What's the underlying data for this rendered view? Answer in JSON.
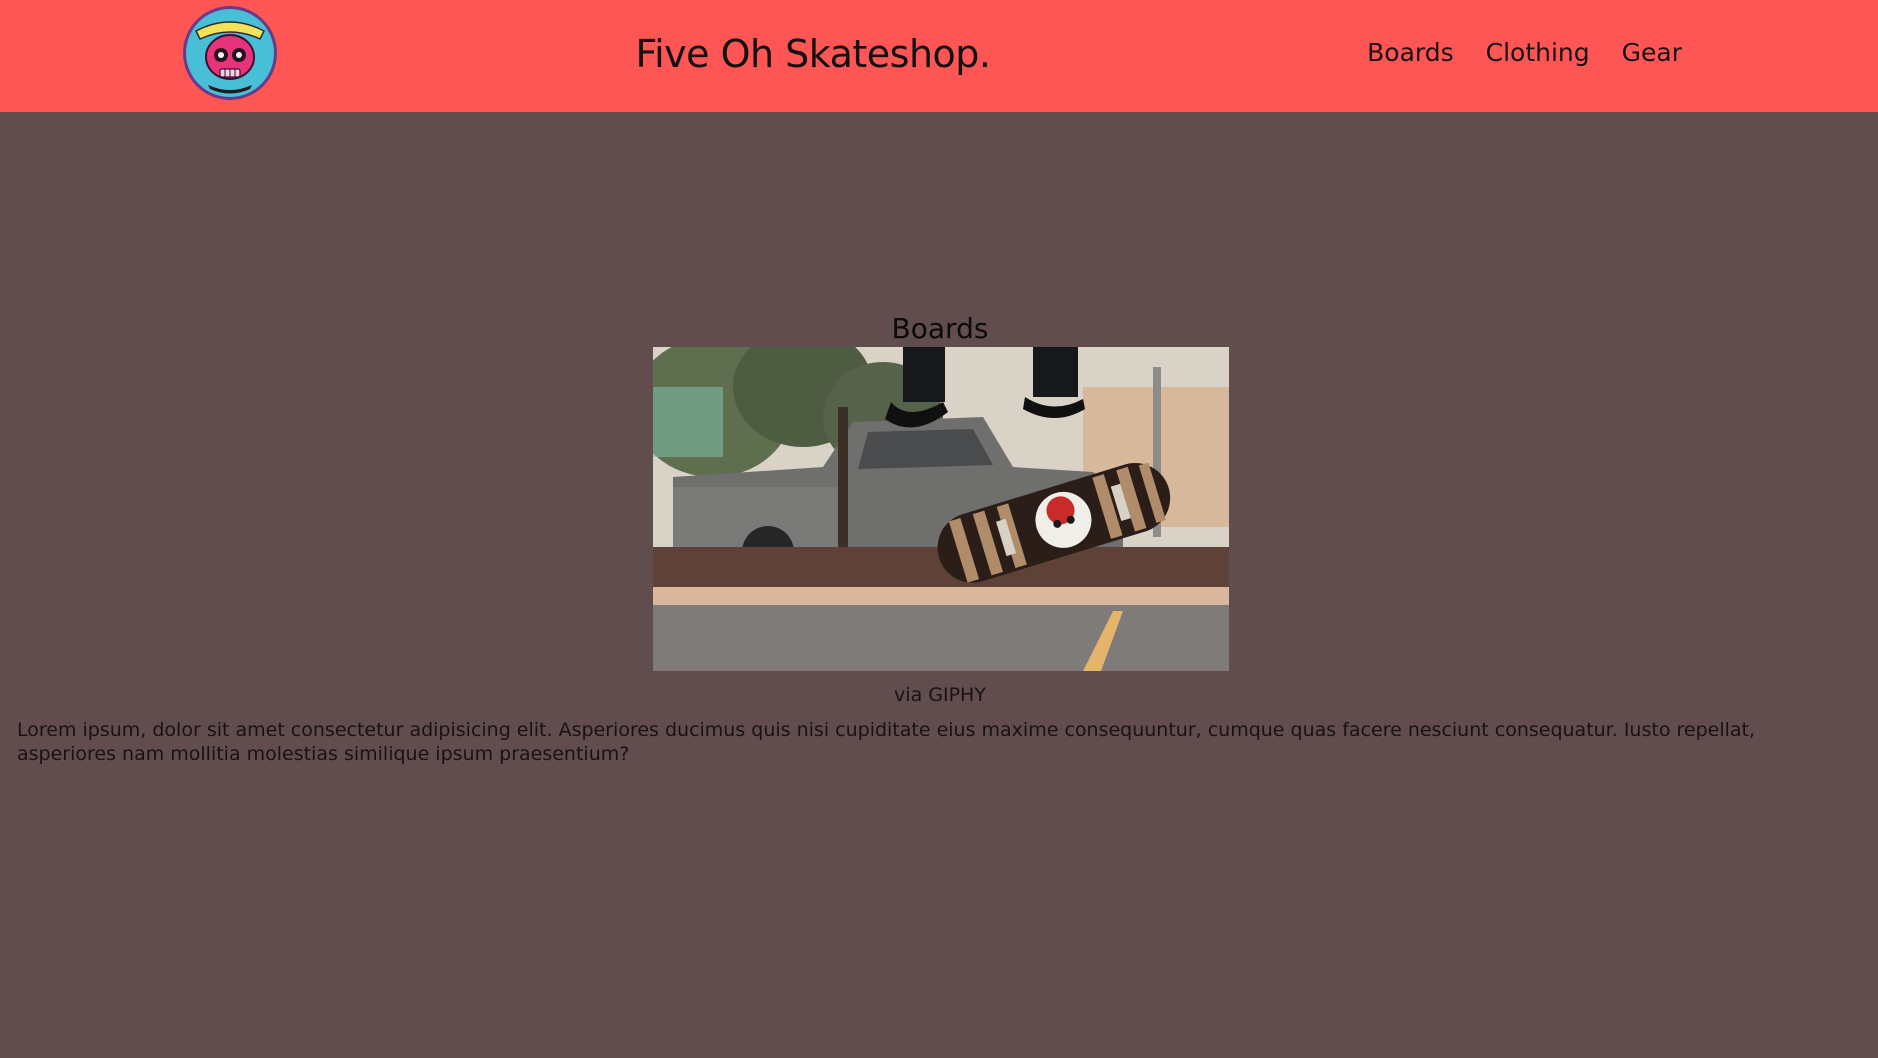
{
  "header": {
    "logo_alt": "Five Oh Skate Shop logo",
    "logo_text_top": "FIVE OH",
    "logo_text_bottom": "SKATE SHOP",
    "title": "Five Oh Skateshop.",
    "nav": [
      {
        "label": "Boards"
      },
      {
        "label": "Clothing"
      },
      {
        "label": "Gear"
      }
    ]
  },
  "main": {
    "section_title": "Boards",
    "gif_alt": "Skateboard kickflip animation",
    "credit_prefix": "via ",
    "credit_link": "GIPHY",
    "paragraph": "Lorem ipsum, dolor sit amet consectetur adipisicing elit. Asperiores ducimus quis nisi cupiditate eius maxime consequuntur, cumque quas facere nesciunt consequatur. Iusto repellat, asperiores nam mollitia molestias similique ipsum praesentium?"
  },
  "colors": {
    "header_bg": "#fe5555",
    "page_bg": "#614d4d",
    "logo_ring": "#4fc3d9",
    "logo_skull": "#e8337a"
  }
}
